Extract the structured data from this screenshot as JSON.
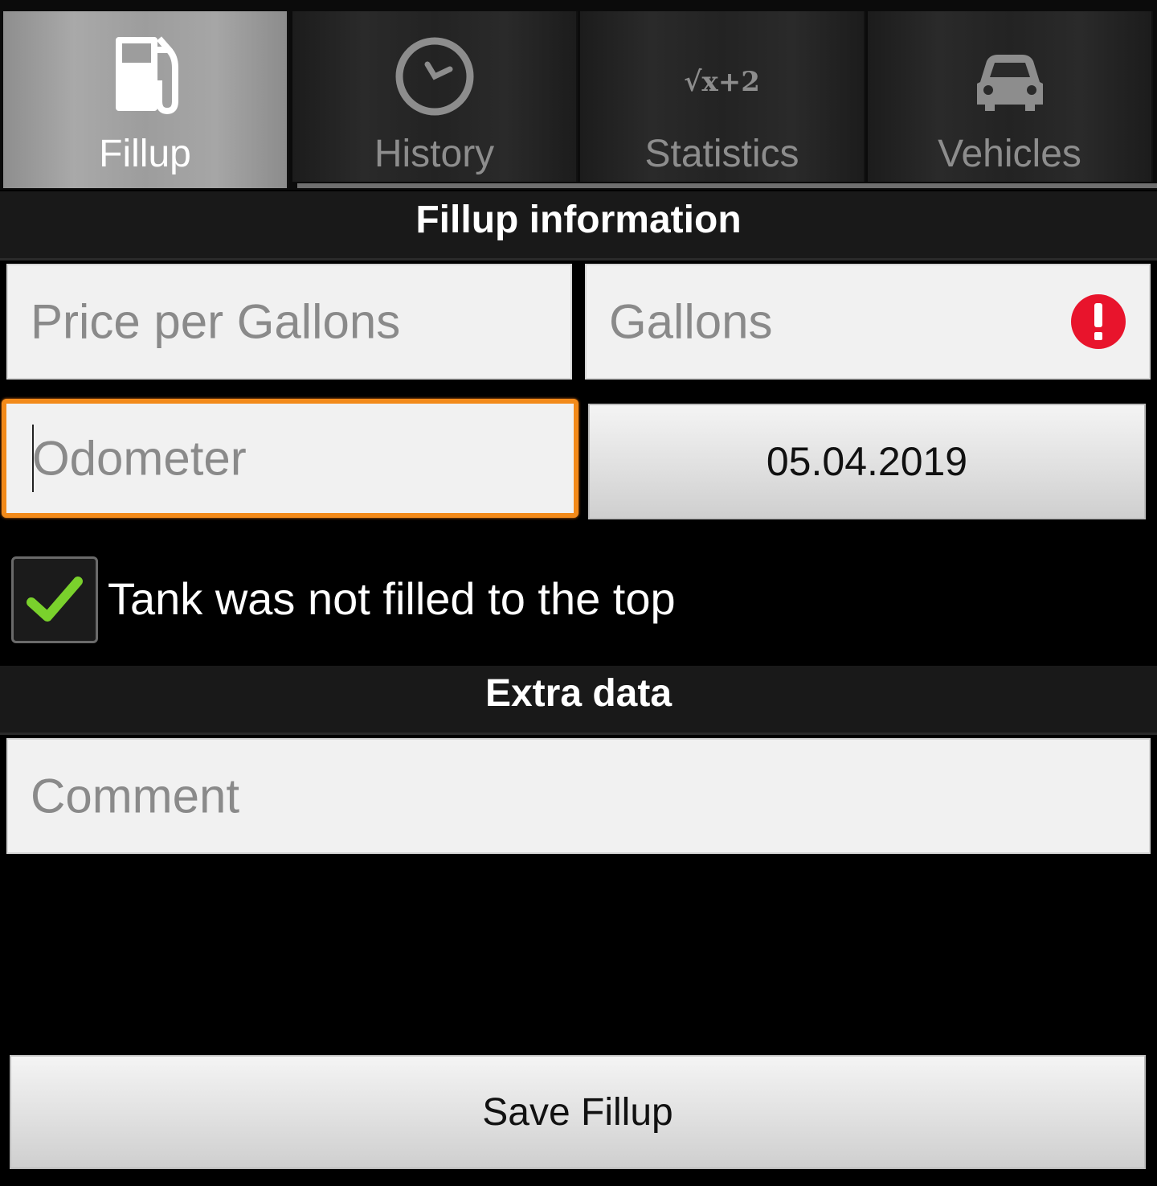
{
  "tabs": [
    {
      "label": "Fillup",
      "icon": "fuel-pump-icon",
      "active": true
    },
    {
      "label": "History",
      "icon": "clock-icon",
      "active": false
    },
    {
      "label": "Statistics",
      "icon": "sqrt-formula-icon",
      "active": false
    },
    {
      "label": "Vehicles",
      "icon": "car-icon",
      "active": false
    }
  ],
  "statistics_icon_text": "√x+2",
  "sections": {
    "fillup_info": "Fillup information",
    "extra_data": "Extra data"
  },
  "fields": {
    "price_per_gallon": {
      "placeholder": "Price per Gallons",
      "value": ""
    },
    "gallons": {
      "placeholder": "Gallons",
      "value": "",
      "error": true
    },
    "odometer": {
      "placeholder": "Odometer",
      "value": "",
      "focused": true
    },
    "comment": {
      "placeholder": "Comment",
      "value": ""
    }
  },
  "date_button": {
    "label": "05.04.2019"
  },
  "checkbox": {
    "label": "Tank was not filled to the top",
    "checked": true
  },
  "save_button": {
    "label": "Save Fillup"
  },
  "colors": {
    "background": "#000000",
    "focus_border": "#f28a1a",
    "error": "#e8142c",
    "check": "#7ad12c",
    "active_tab": "#a0a0a0"
  }
}
